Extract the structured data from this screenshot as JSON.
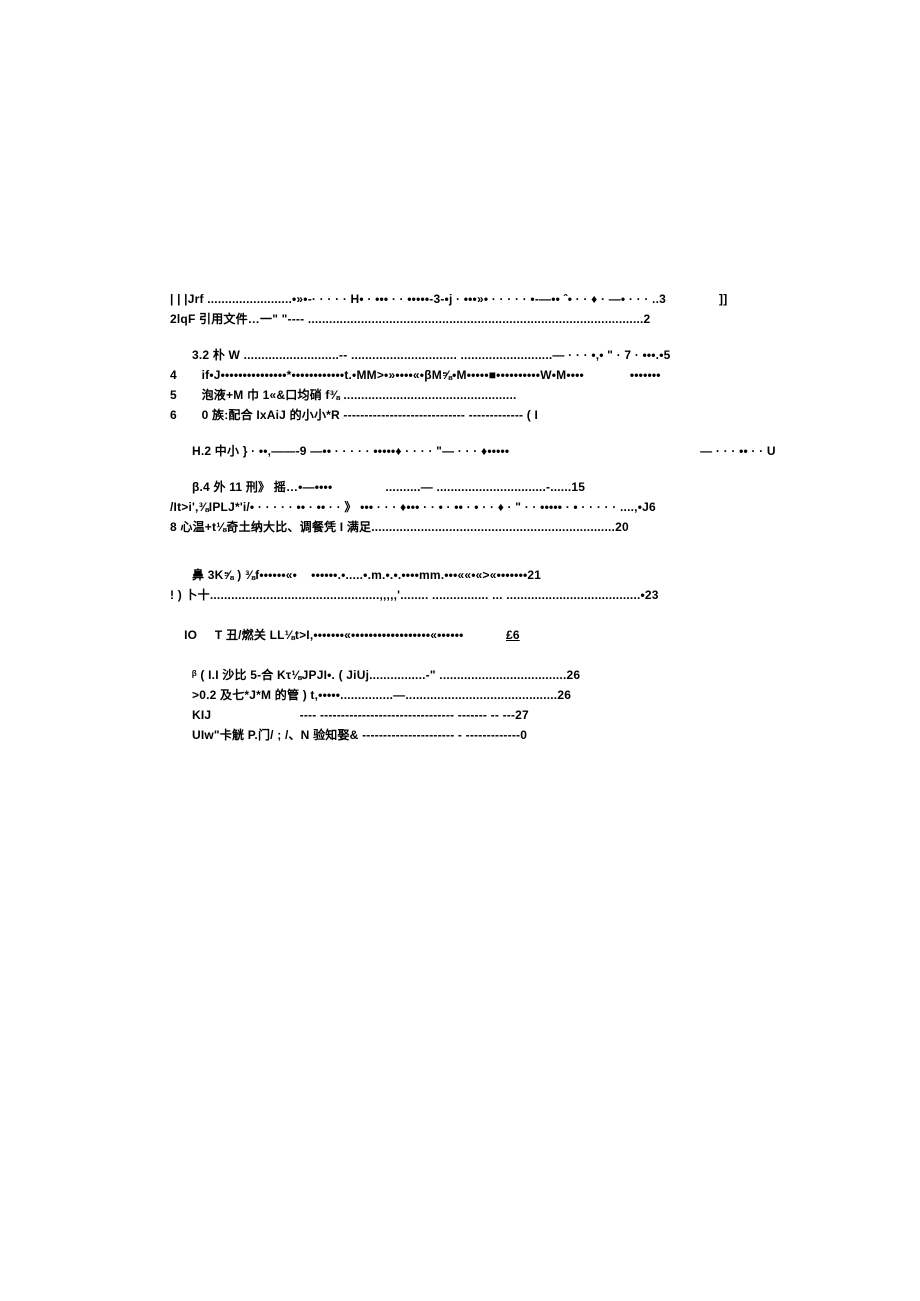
{
  "toc": {
    "l1": "| | |Jrf ........................•»•‑· · · · · H• · ••• · · •••••-3-•j · •••»• · · · · · •-—•• ˆ• · · ♦ · —• · · · ..3               ]]",
    "l2": "2lqF 引用文件…一\" \"---- ...............................................................................................2",
    "l3": "3.2 朴 W ...........................-- .............................. ..........................— · · · •,• \" · 7 · •••.•5",
    "l4": "4       if•J•••••••••••••••*••••••••••••t.•MM>•»••••«•βM⅝•M•••••■••••••••••W•M••••             •••••••",
    "l5": "5       泡液+M 巾 1«&口均硝 f⅜ .................................................",
    "l6": "6       0 族:配合 IxAiJ 的小小*R ----------------------------- ------------- ( I",
    "l7": "H.2 中小 } · ••,——-9 —•• · · · · · •••••♦ · · · · \"— · · · ♦•••••                                                      — · · · •• · · U",
    "l8": "β.4 外 11 刑》 摇…•—••••               ..........— ...............................-......15",
    "l9": "/It>i',⅜IPLJ*'i/• · · · · · •• · •• · · 》 ••• · · · ♦••• · · • · •• · • · · ♦ · \" · · ••••• · • · · · · · ....,•J6",
    "l10": "8 心温+t⅛奇土纳大比、调餐凭 I 满足.....................................................................20",
    "l11": "鼻 3K⅝ ) ⅜f••••••«•    ••••••.•.....•.m.•.•.••••mm.•••««•«>«•••••••21",
    "l12": "! ) 卜十................................................,,,,,'........ ................ ... ......................................•23",
    "l13a": "IO     T 丑/燃关 LL⅛t>I,•••••••«••••••••••••••••••«••••••            ",
    "l13b": "£6",
    "l14": "ᵝ ( I.I 沙比 5-合 Kτ⅛JPJI•. ( JiUj................-\" ....................................26",
    "l15": ">0.2 及七*J*M 的管 ) t,•••••...............—...........................................26",
    "l16": "KIJ                         ---- -------------------------------- ------- -- ---27",
    "l17": "UIw\"卡觥 P.门/ ; /、N 验知娶& ---------------------- - -------------0"
  }
}
